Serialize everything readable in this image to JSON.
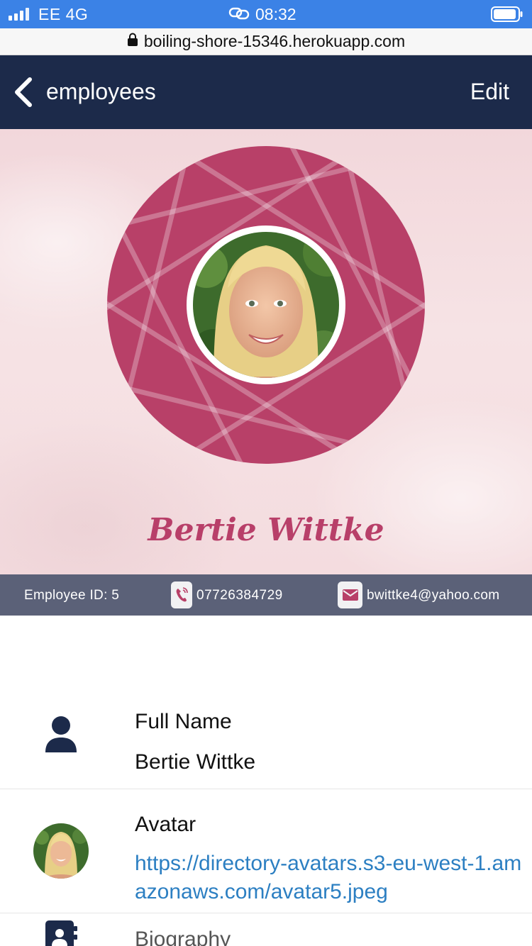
{
  "status_bar": {
    "carrier": "EE 4G",
    "time": "08:32",
    "signal_icon": "signal-bars-icon",
    "link_icon": "link-icon",
    "battery_icon": "battery-icon"
  },
  "url_bar": {
    "lock_icon": "lock-icon",
    "url": "boiling-shore-15346.herokuapp.com"
  },
  "header": {
    "back_icon": "chevron-left-icon",
    "title": "employees",
    "edit_label": "Edit"
  },
  "profile": {
    "name": "Bertie Wittke",
    "employee_id_label": "Employee ID: 5",
    "phone": "07726384729",
    "email": "bwittke4@yahoo.com",
    "phone_icon": "phone-icon",
    "email_icon": "envelope-icon"
  },
  "details": [
    {
      "icon": "user-icon",
      "label": "Full Name",
      "value": "Bertie Wittke"
    },
    {
      "icon": "avatar-thumbnail",
      "label": "Avatar",
      "value": "https://directory-avatars.s3-eu-west-1.amazonaws.com/avatar5.jpeg"
    },
    {
      "icon": "address-book-icon",
      "label": "Biography"
    }
  ],
  "colors": {
    "status_bar": "#3b82e6",
    "header_bg": "#1c2a4a",
    "accent": "#b83f69",
    "info_strip": "#5b6178",
    "link": "#2c7fc2"
  }
}
